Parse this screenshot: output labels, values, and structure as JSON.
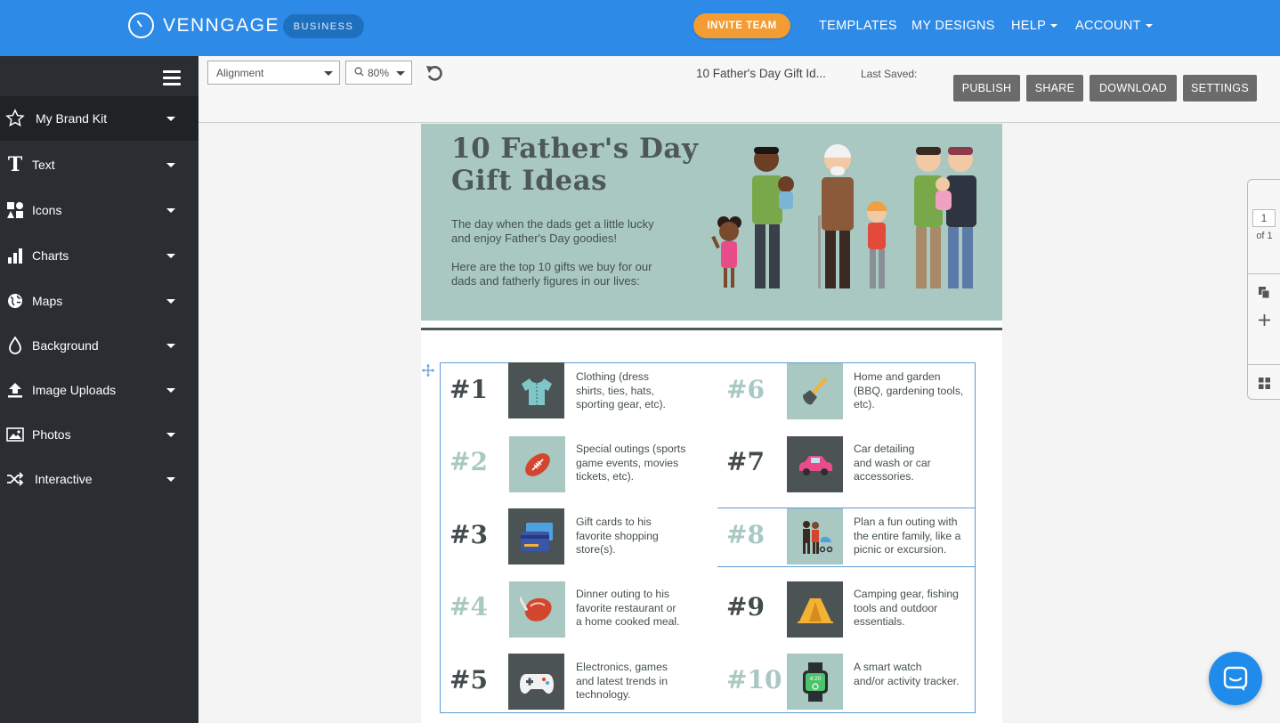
{
  "app": {
    "brand": "VENNGAGE",
    "plan_badge": "BUSINESS",
    "invite_label": "INVITE TEAM",
    "nav": [
      "TEMPLATES",
      "MY DESIGNS",
      "HELP",
      "ACCOUNT"
    ]
  },
  "sidebar": {
    "items": [
      {
        "label": "My Brand Kit",
        "icon": "star-icon"
      },
      {
        "label": "Text",
        "icon": "text-icon"
      },
      {
        "label": "Icons",
        "icon": "shapes-icon"
      },
      {
        "label": "Charts",
        "icon": "bar-chart-icon"
      },
      {
        "label": "Maps",
        "icon": "globe-icon"
      },
      {
        "label": "Background",
        "icon": "droplet-icon"
      },
      {
        "label": "Image Uploads",
        "icon": "upload-icon"
      },
      {
        "label": "Photos",
        "icon": "photo-icon"
      },
      {
        "label": "Interactive",
        "icon": "shuffle-icon"
      }
    ]
  },
  "toolbar": {
    "alignment": "Alignment",
    "zoom": "80%",
    "doc_title": "10 Father's Day Gift Id...",
    "last_saved": "Last Saved:",
    "buttons": [
      "PUBLISH",
      "SHARE",
      "DOWNLOAD",
      "SETTINGS"
    ]
  },
  "infographic": {
    "title_line1": "10 Father's Day",
    "title_line2": "Gift Ideas",
    "para1_line1": "The day when the dads get a little lucky",
    "para1_line2": "and enjoy Father's Day goodies!",
    "para2_line1": "Here are the top 10 gifts we buy for our",
    "para2_line2": "dads and fatherly figures in our lives:",
    "gifts": [
      {
        "num": "#1",
        "lines": [
          "Clothing (dress",
          "shirts, ties, hats,",
          "sporting gear, etc)."
        ],
        "icon": "shirt-icon"
      },
      {
        "num": "#2",
        "lines": [
          "Special outings (sports",
          "game events, movies",
          "tickets, etc)."
        ],
        "icon": "football-icon"
      },
      {
        "num": "#3",
        "lines": [
          "Gift cards to his",
          "favorite shopping",
          "store(s)."
        ],
        "icon": "credit-card-icon"
      },
      {
        "num": "#4",
        "lines": [
          "Dinner outing to his",
          "favorite restaurant or",
          "a home cooked meal."
        ],
        "icon": "steak-icon"
      },
      {
        "num": "#5",
        "lines": [
          "Electronics, games",
          "and latest trends in",
          "technology."
        ],
        "icon": "gamepad-icon"
      },
      {
        "num": "#6",
        "lines": [
          "Home and garden",
          "(BBQ, gardening tools,",
          "etc)."
        ],
        "icon": "shovel-icon"
      },
      {
        "num": "#7",
        "lines": [
          "Car detailing",
          "and wash or car",
          "accessories."
        ],
        "icon": "car-icon"
      },
      {
        "num": "#8",
        "lines": [
          "Plan a fun outing with",
          "the entire family, like a",
          "picnic or excursion."
        ],
        "icon": "family-icon"
      },
      {
        "num": "#9",
        "lines": [
          "Camping gear, fishing",
          "tools and outdoor",
          "essentials."
        ],
        "icon": "tent-icon"
      },
      {
        "num": "#10",
        "lines": [
          "A smart watch",
          "and/or activity tracker."
        ],
        "icon": "smartwatch-icon",
        "watch_time": "4:20"
      }
    ]
  },
  "rail": {
    "page": "1",
    "of": "of 1"
  },
  "colors": {
    "topbar": "#2d8ae6",
    "sidebar": "#2a2d31",
    "accent_orange": "#f39c33",
    "sage": "#a8c8c1",
    "tile_dark": "#4b5354"
  }
}
